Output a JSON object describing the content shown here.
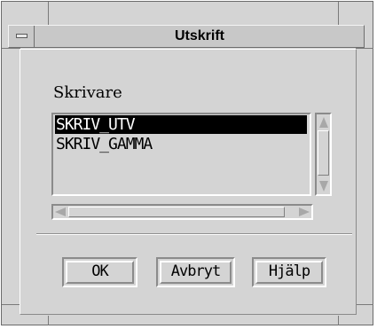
{
  "window": {
    "title": "Utskrift"
  },
  "dialog": {
    "printer_label": "Skrivare",
    "printers": [
      {
        "name": "SKRIV_UTV",
        "selected": true
      },
      {
        "name": "SKRIV_GAMMA",
        "selected": false
      }
    ],
    "buttons": {
      "ok": "OK",
      "cancel": "Avbryt",
      "help": "Hjälp"
    }
  },
  "theme": {
    "background": "#d4d4d4",
    "selection_background": "#000000",
    "selection_text": "#ffffff",
    "text": "#000000"
  },
  "icons": {
    "window_menu": "window-menu-icon",
    "scroll_up": "scroll-up-arrow-icon",
    "scroll_down": "scroll-down-arrow-icon",
    "scroll_left": "scroll-left-arrow-icon",
    "scroll_right": "scroll-right-arrow-icon"
  }
}
